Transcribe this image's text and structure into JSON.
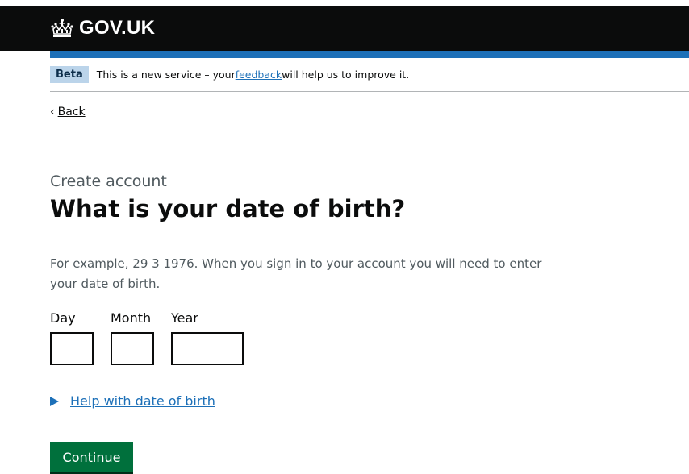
{
  "header": {
    "logo_text": "GOV.UK",
    "logo_icon": "crown-icon",
    "colors": {
      "header_bg": "#0b0c0c",
      "accent": "#1d70b8"
    }
  },
  "phase_banner": {
    "tag": "Beta",
    "text_before": "This is a new service – your ",
    "link_text": "feedback",
    "text_after": " will help us to improve it."
  },
  "back_link": {
    "label": "Back",
    "icon": "chevron-left-icon"
  },
  "form": {
    "caption": "Create account",
    "heading": "What is your date of birth?",
    "hint": "For example, 29 3 1976. When you sign in to your account you will need to enter your date of birth.",
    "fields": {
      "day": {
        "label": "Day",
        "value": ""
      },
      "month": {
        "label": "Month",
        "value": ""
      },
      "year": {
        "label": "Year",
        "value": ""
      }
    },
    "help_link": "Help with date of birth",
    "submit_label": "Continue",
    "submit_color": "#00703c"
  }
}
